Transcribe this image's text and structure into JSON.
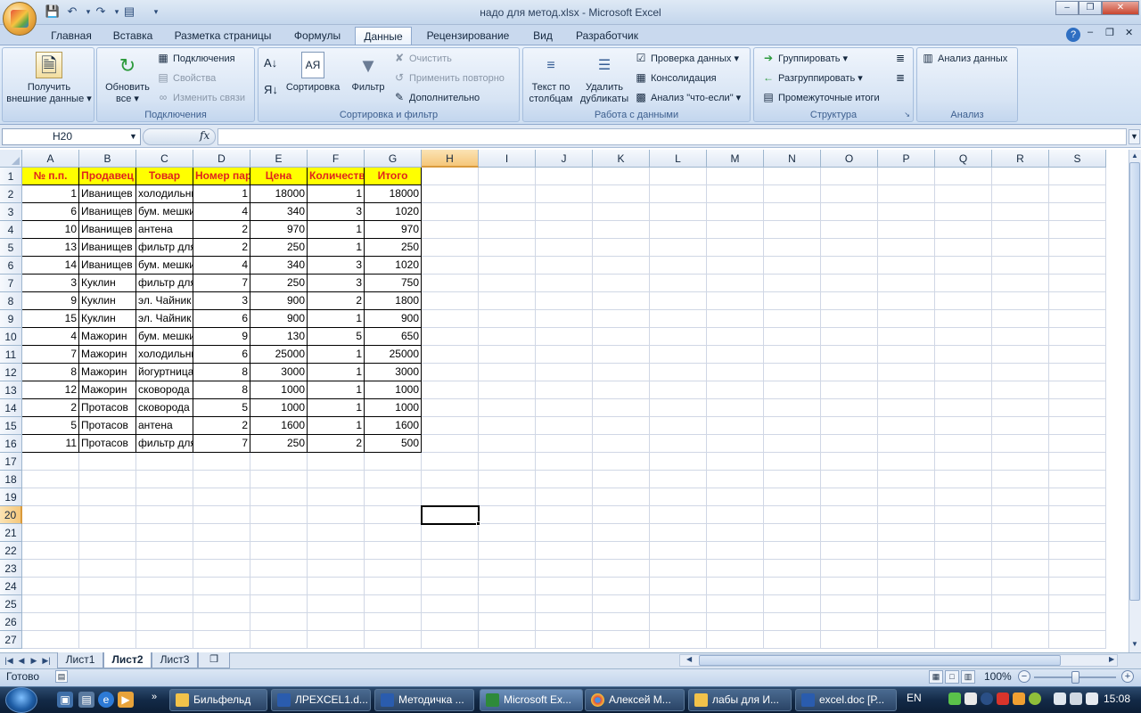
{
  "window": {
    "title": "надо для метод.xlsx - Microsoft Excel"
  },
  "ribbon_tabs": [
    "Главная",
    "Вставка",
    "Разметка страницы",
    "Формулы",
    "Данные",
    "Рецензирование",
    "Вид",
    "Разработчик"
  ],
  "active_tab": "Данные",
  "ribbon": {
    "groups": {
      "connections": "Подключения",
      "sort_filter": "Сортировка и фильтр",
      "data_tools": "Работа с данными",
      "outline": "Структура",
      "analysis": "Анализ"
    },
    "get_external": [
      "Получить",
      "внешние данные"
    ],
    "refresh_all": [
      "Обновить",
      "все"
    ],
    "connections_btn": "Подключения",
    "properties_btn": "Свойства",
    "edit_links_btn": "Изменить связи",
    "sort_btn": "Сортировка",
    "filter_btn": "Фильтр",
    "clear_btn": "Очистить",
    "reapply_btn": "Применить повторно",
    "advanced_btn": "Дополнительно",
    "text_to_columns": [
      "Текст по",
      "столбцам"
    ],
    "remove_duplicates": [
      "Удалить",
      "дубликаты"
    ],
    "data_validation": "Проверка данных",
    "consolidate": "Консолидация",
    "what_if": "Анализ \"что-если\"",
    "group_btn": "Группировать",
    "ungroup_btn": "Разгруппировать",
    "subtotal_btn": "Промежуточные итоги",
    "data_analysis": "Анализ данных"
  },
  "formula_bar": {
    "name_box": "H20",
    "fx": "fx",
    "formula": ""
  },
  "columns": [
    "A",
    "B",
    "C",
    "D",
    "E",
    "F",
    "G",
    "H",
    "I",
    "J",
    "K",
    "L",
    "M",
    "N",
    "O",
    "P",
    "Q",
    "R",
    "S"
  ],
  "selected_column": "H",
  "selected_row": 20,
  "row_numbers": [
    1,
    2,
    3,
    4,
    5,
    6,
    7,
    8,
    9,
    10,
    11,
    12,
    13,
    14,
    15,
    16,
    17,
    18,
    19,
    20,
    21,
    22,
    23,
    24,
    25,
    26,
    27
  ],
  "table": {
    "headers": [
      "№ п.п.",
      "Продавец",
      "Товар",
      "Номер партии",
      "Цена",
      "Количество",
      "Итого"
    ],
    "rows": [
      [
        "1",
        "Иванищев",
        "холодильник",
        "1",
        "18000",
        "1",
        "18000"
      ],
      [
        "6",
        "Иванищев",
        "бум. мешки",
        "4",
        "340",
        "3",
        "1020"
      ],
      [
        "10",
        "Иванищев",
        "антена",
        "2",
        "970",
        "1",
        "970"
      ],
      [
        "13",
        "Иванищев",
        "фильтр для",
        "2",
        "250",
        "1",
        "250"
      ],
      [
        "14",
        "Иванищев",
        "бум. мешки",
        "4",
        "340",
        "3",
        "1020"
      ],
      [
        "3",
        "Куклин",
        "фильтр для",
        "7",
        "250",
        "3",
        "750"
      ],
      [
        "9",
        "Куклин",
        "эл. Чайник",
        "3",
        "900",
        "2",
        "1800"
      ],
      [
        "15",
        "Куклин",
        "эл. Чайник",
        "6",
        "900",
        "1",
        "900"
      ],
      [
        "4",
        "Мажорин",
        "бум. мешки",
        "9",
        "130",
        "5",
        "650"
      ],
      [
        "7",
        "Мажорин",
        "холодильник",
        "6",
        "25000",
        "1",
        "25000"
      ],
      [
        "8",
        "Мажорин",
        "йогуртница",
        "8",
        "3000",
        "1",
        "3000"
      ],
      [
        "12",
        "Мажорин",
        "сковорода",
        "8",
        "1000",
        "1",
        "1000"
      ],
      [
        "2",
        "Протасов",
        "сковорода",
        "5",
        "1000",
        "1",
        "1000"
      ],
      [
        "5",
        "Протасов",
        "антена",
        "2",
        "1600",
        "1",
        "1600"
      ],
      [
        "11",
        "Протасов",
        "фильтр для",
        "7",
        "250",
        "2",
        "500"
      ]
    ]
  },
  "sheets": [
    "Лист1",
    "Лист2",
    "Лист3"
  ],
  "active_sheet": "Лист2",
  "status": {
    "text": "Готово",
    "zoom": "100%"
  },
  "taskbar": {
    "buttons": [
      "Бильфельд",
      "ЛРEXCEL1.d...",
      "Методичка ...",
      "Microsoft Ex...",
      "Алексей М...",
      "лабы для И...",
      "excel.doc [Р..."
    ],
    "active_index": 3,
    "lang": "EN",
    "clock": "15:08"
  },
  "colors": {
    "header_fill": "#ffff00",
    "header_text": "#e0241c",
    "selection_highlight": "#f5c77a"
  }
}
